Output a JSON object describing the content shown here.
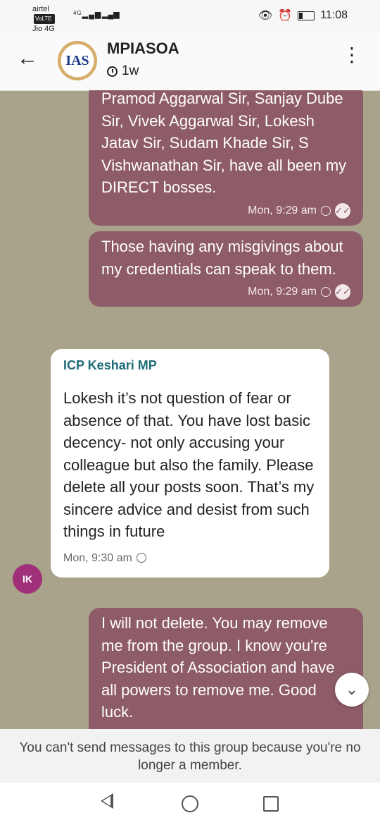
{
  "status_bar": {
    "carrier1": "airtel",
    "carrier2": "Jio 4G",
    "volte": "VoLTE",
    "network": "4G",
    "time": "11:08"
  },
  "header": {
    "title": "MPIASOA",
    "logo_text": "IAS",
    "last_seen": "1w"
  },
  "messages": [
    {
      "direction": "out",
      "text": "Pramod Aggarwal Sir, Sanjay Dube Sir, Vivek Aggarwal Sir, Lokesh Jatav Sir, Sudam Khade Sir, S Vishwanathan Sir, have all been my DIRECT bosses.",
      "time": "Mon, 9:29 am"
    },
    {
      "direction": "out",
      "text": "Those having any misgivings about my credentials can speak to them.",
      "time": "Mon, 9:29 am"
    },
    {
      "direction": "in",
      "sender": "ICP Keshari MP",
      "avatar": "IK",
      "text": "Lokesh it’s not question of fear or absence of that. You have lost basic decency- not only accusing your colleague but also the family. Please delete all your posts soon. That’s my sincere advice and desist from such things in future",
      "time": "Mon, 9:30 am"
    },
    {
      "direction": "out",
      "text": "I will not delete. You may remove me from the group. I know you're President of Association and have all powers to remove me. Good luck."
    }
  ],
  "footer": {
    "notice": "You can't send messages to this group because you're no longer a member."
  },
  "colors": {
    "chat_background": "#a8a38a",
    "outgoing_bubble": "#8e5b68",
    "incoming_bubble": "#ffffff",
    "sender_name": "#1e6b77",
    "avatar": "#a0307a"
  }
}
